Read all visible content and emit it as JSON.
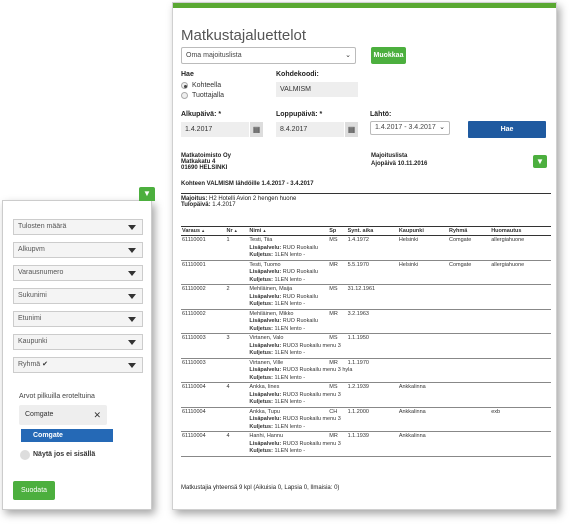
{
  "main": {
    "title": "Matkustajaluettelot",
    "list_select": "Oma majoituslista",
    "edit_button": "Muokkaa",
    "search_label": "Hae",
    "radio_by_target": "Kohteella",
    "radio_by_product": "Tuottajalla",
    "target_code_label": "Kohdekoodi:",
    "target_code_value": "VALMISM",
    "start_label": "Alkupäivä: *",
    "start_value": "1.4.2017",
    "end_label": "Loppupäivä: *",
    "end_value": "8.4.2017",
    "departure_label": "Lähtö:",
    "departure_value": "1.4.2017 - 3.4.2017",
    "search_button": "Hae",
    "calendar_icon": "calendar-icon"
  },
  "report": {
    "agency_name": "Matkatoimisto Oy",
    "agency_street": "Matkakatu 4",
    "agency_city": "01690 HELSINKI",
    "list_type": "Majoituslista",
    "run_date": "Ajopäivä 10.11.2016",
    "heading": "Kohteen VALMISM lähdöille 1.4.2017 - 3.4.2017",
    "accommodation_label": "Majoitus",
    "accommodation_value": "H2 Hotelli Avion 2 hengen huone",
    "arrival_label": "Tulopäivä",
    "arrival_value": "1.4.2017",
    "columns": [
      "Varaus",
      "Nr",
      "Nimi",
      "Sp",
      "Synt. aika",
      "Kaupunki",
      "Ryhmä",
      "Huomautus"
    ],
    "rows": [
      {
        "varaus": "61110001",
        "nr": "1",
        "nimi": "Testi, Tiia",
        "sp": "MS",
        "synt": "1.4.1972",
        "kaupunki": "Helsinki",
        "ryhma": "Comgate",
        "huom": "allergiahuone",
        "lisa": "RUO Ruokailu",
        "kul": "1LEN lento -"
      },
      {
        "varaus": "61110001",
        "nr": "",
        "nimi": "Testi, Tuomo",
        "sp": "MR",
        "synt": "5.5.1970",
        "kaupunki": "Helsinki",
        "ryhma": "Comgate",
        "huom": "allergiahuone",
        "lisa": "RUO Ruokailu",
        "kul": "1LEN lento -"
      },
      {
        "varaus": "61110002",
        "nr": "2",
        "nimi": "Mehiläinen, Maija",
        "sp": "MS",
        "synt": "31.12.1961",
        "kaupunki": "",
        "ryhma": "",
        "huom": "",
        "lisa": "RUO Ruokailu",
        "kul": "1LEN lento -"
      },
      {
        "varaus": "61110002",
        "nr": "",
        "nimi": "Mehiläinen, Mikko",
        "sp": "MR",
        "synt": "3.2.1963",
        "kaupunki": "",
        "ryhma": "",
        "huom": "",
        "lisa": "RUO Ruokailu",
        "kul": "1LEN lento -"
      },
      {
        "varaus": "61110003",
        "nr": "3",
        "nimi": "Virtanen, Valo",
        "sp": "MS",
        "synt": "1.1.1950",
        "kaupunki": "",
        "ryhma": "",
        "huom": "",
        "lisa": "RUO3 Ruokailu menu 3",
        "kul": "1LEN lento -"
      },
      {
        "varaus": "61110003",
        "nr": "",
        "nimi": "Virtanen, Ville",
        "sp": "MR",
        "synt": "1.1.1970",
        "kaupunki": "",
        "ryhma": "",
        "huom": "",
        "lisa": "RUO3 Ruokailu menu 3 hyla",
        "kul": "1LEN lento -"
      },
      {
        "varaus": "61110004",
        "nr": "4",
        "nimi": "Ankka, Iines",
        "sp": "MS",
        "synt": "1.2.1939",
        "kaupunki": "Ankkalinna",
        "ryhma": "",
        "huom": "",
        "lisa": "RUO3 Ruokailu menu 3",
        "kul": "1LEN lento -"
      },
      {
        "varaus": "61110004",
        "nr": "",
        "nimi": "Ankka, Tupu",
        "sp": "CH",
        "synt": "1.1.2000",
        "kaupunki": "Ankkalinna",
        "ryhma": "",
        "huom": "exb",
        "lisa": "RUO3 Ruokailu menu 3",
        "kul": "1LEN lento -"
      },
      {
        "varaus": "61110004",
        "nr": "4",
        "nimi": "Hanhi, Hannu",
        "sp": "MR",
        "synt": "1.1.1939",
        "kaupunki": "Ankkalinna",
        "ryhma": "",
        "huom": "",
        "lisa": "RUO3 Ruokailu menu 3",
        "kul": "1LEN lento -"
      }
    ],
    "extra_label": "Lisäpalvelu:",
    "transport_label": "Kuljetus:",
    "footer": "Matkustajia yhteensä 9 kpl (Aikuisia 0, Lapsia 0, Ilmaisia: 0)"
  },
  "filters": {
    "items": [
      "Tulosten määrä",
      "Alkupvm",
      "Varausnumero",
      "Sukunimi",
      "Etunimi",
      "Kaupunki",
      "Ryhmä"
    ],
    "checked_item": "Ryhmä",
    "separated_label": "Arvot pilkuilla eroteltuina",
    "chip_value": "Comgate",
    "option_highlight": "Comgate",
    "show_if_not_label": "Näytä jos ei sisällä",
    "apply_button": "Suodata",
    "check_glyph": "✔",
    "close_glyph": "✕"
  }
}
